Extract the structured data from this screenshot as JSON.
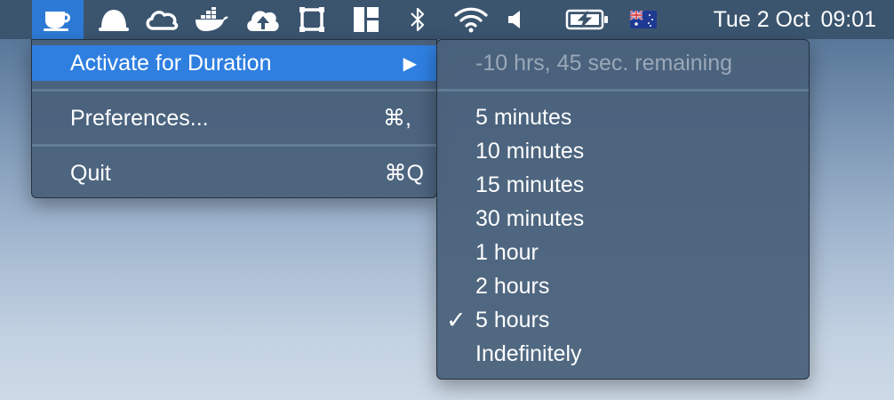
{
  "menubar": {
    "status_icons": [
      {
        "icon": "coffee-cup-icon",
        "active": true
      },
      {
        "icon": "bell-dome-icon"
      },
      {
        "icon": "creative-cloud-icon"
      },
      {
        "icon": "docker-whale-icon"
      },
      {
        "icon": "cloud-upload-icon"
      },
      {
        "icon": "square-frame-icon"
      },
      {
        "icon": "window-layout-icon"
      },
      {
        "icon": "bluetooth-icon"
      },
      {
        "icon": "wifi-icon"
      },
      {
        "icon": "volume-icon"
      },
      {
        "icon": "battery-charging-icon"
      },
      {
        "icon": "australia-flag-icon"
      }
    ],
    "date": "Tue 2 Oct",
    "time": "09:01",
    "accent_color": "#2d7ad6"
  },
  "main_menu": {
    "items": [
      {
        "label": "Activate for Duration",
        "arrow": "▶",
        "highlighted": true
      },
      {
        "label": "Preferences...",
        "shortcut": "⌘,"
      },
      {
        "label": "Quit",
        "shortcut": "⌘Q"
      }
    ]
  },
  "duration_menu": {
    "status": "-10 hrs, 45 sec. remaining",
    "checkmark": "✓",
    "options": [
      {
        "label": "5 minutes"
      },
      {
        "label": "10 minutes"
      },
      {
        "label": "15 minutes"
      },
      {
        "label": "30 minutes"
      },
      {
        "label": "1 hour"
      },
      {
        "label": "2 hours"
      },
      {
        "label": "5 hours",
        "checked": true
      },
      {
        "label": "Indefinitely"
      }
    ]
  }
}
